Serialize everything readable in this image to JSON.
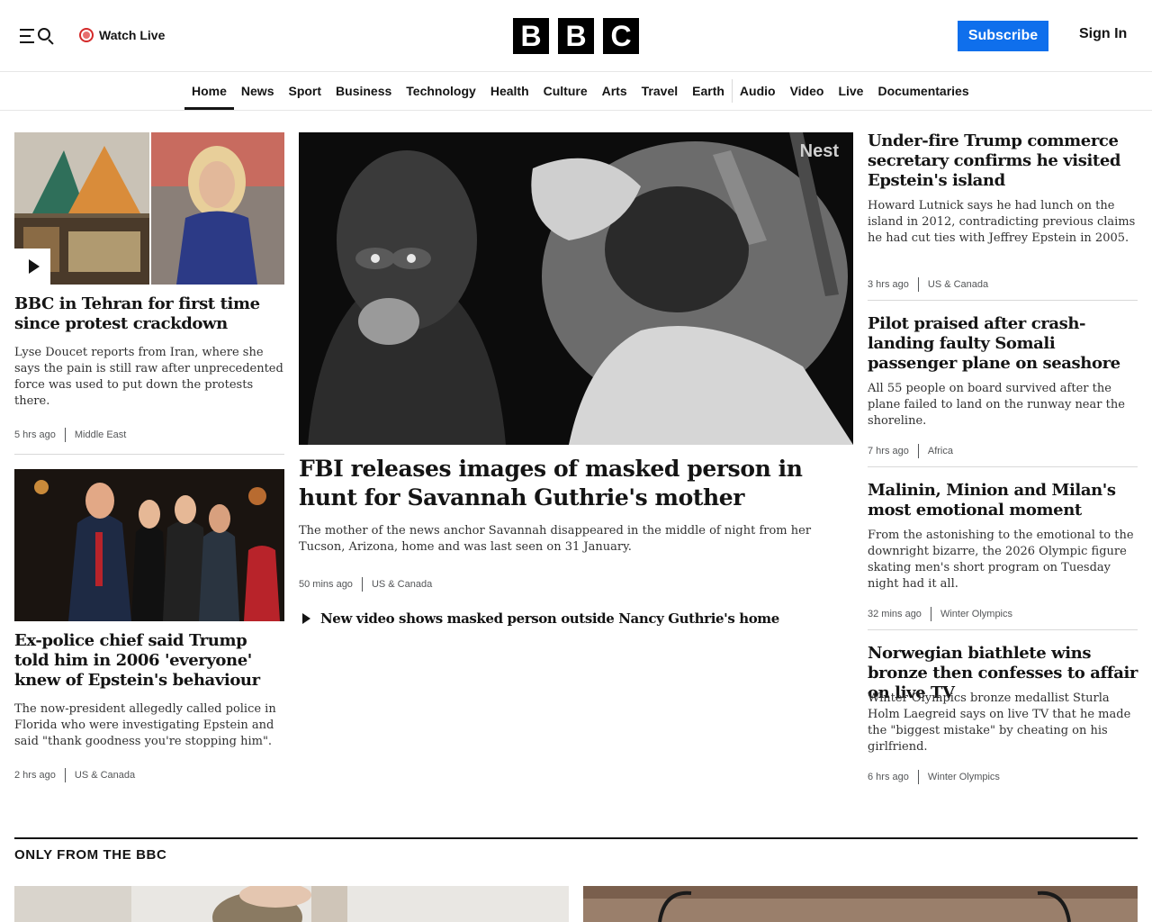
{
  "header": {
    "watch_live": "Watch Live",
    "logo_letters": [
      "B",
      "B",
      "C"
    ],
    "subscribe": "Subscribe",
    "sign_in": "Sign In"
  },
  "nav": {
    "items": [
      "Home",
      "News",
      "Sport",
      "Business",
      "Technology",
      "Health",
      "Culture",
      "Arts",
      "Travel",
      "Earth",
      "Audio",
      "Video",
      "Live",
      "Documentaries"
    ],
    "active": "Home"
  },
  "left": {
    "story1": {
      "headline": "BBC in Tehran for first time since protest crackdown",
      "summary": "Lyse Doucet reports from Iran, where she says the pain is still raw after unprecedented force was used to put down the protests there.",
      "time": "5 hrs ago",
      "topic": "Middle East",
      "media_icon": "play-icon"
    },
    "story2": {
      "headline": "Ex-police chief said Trump told him in 2006 'everyone' knew of Epstein's behaviour",
      "summary": "The now-president allegedly called police in Florida who were investigating Epstein and said \"thank goodness you're stopping him\".",
      "time": "2 hrs ago",
      "topic": "US & Canada"
    }
  },
  "lead": {
    "image_watermark": "Nest",
    "headline": "FBI releases images of masked person in hunt for Savannah Guthrie's mother",
    "summary": "The mother of the news anchor Savannah disappeared in the middle of night from her Tucson, Arizona, home and was last seen on 31 January.",
    "time": "50 mins ago",
    "topic": "US & Canada",
    "related_link": "New video shows masked person outside Nancy Guthrie's home"
  },
  "right": [
    {
      "headline": "Under-fire Trump commerce secretary confirms he visited Epstein's island",
      "summary": "Howard Lutnick says he had lunch on the island in 2012, contradicting previous claims he had cut ties with Jeffrey Epstein in 2005.",
      "time": "3 hrs ago",
      "topic": "US & Canada"
    },
    {
      "headline": "Pilot praised after crash-landing faulty Somali passenger plane on seashore",
      "summary": "All 55 people on board survived after the plane failed to land on the runway near the shoreline.",
      "time": "7 hrs ago",
      "topic": "Africa"
    },
    {
      "headline": "Malinin, Minion and Milan's most emotional moment",
      "summary": "From the astonishing to the emotional to the downright bizarre, the 2026 Olympic figure skating men's short program on Tuesday night had it all.",
      "time": "32 mins ago",
      "topic": "Winter Olympics"
    },
    {
      "headline": "Norwegian biathlete wins bronze then confesses to affair on live TV",
      "summary": "Winter Olympics bronze medallist Sturla Holm Laegreid says on live TV that he made the \"biggest mistake\" by cheating on his girlfriend.",
      "time": "6 hrs ago",
      "topic": "Winter Olympics"
    }
  ],
  "section": {
    "title": "ONLY FROM THE BBC"
  }
}
